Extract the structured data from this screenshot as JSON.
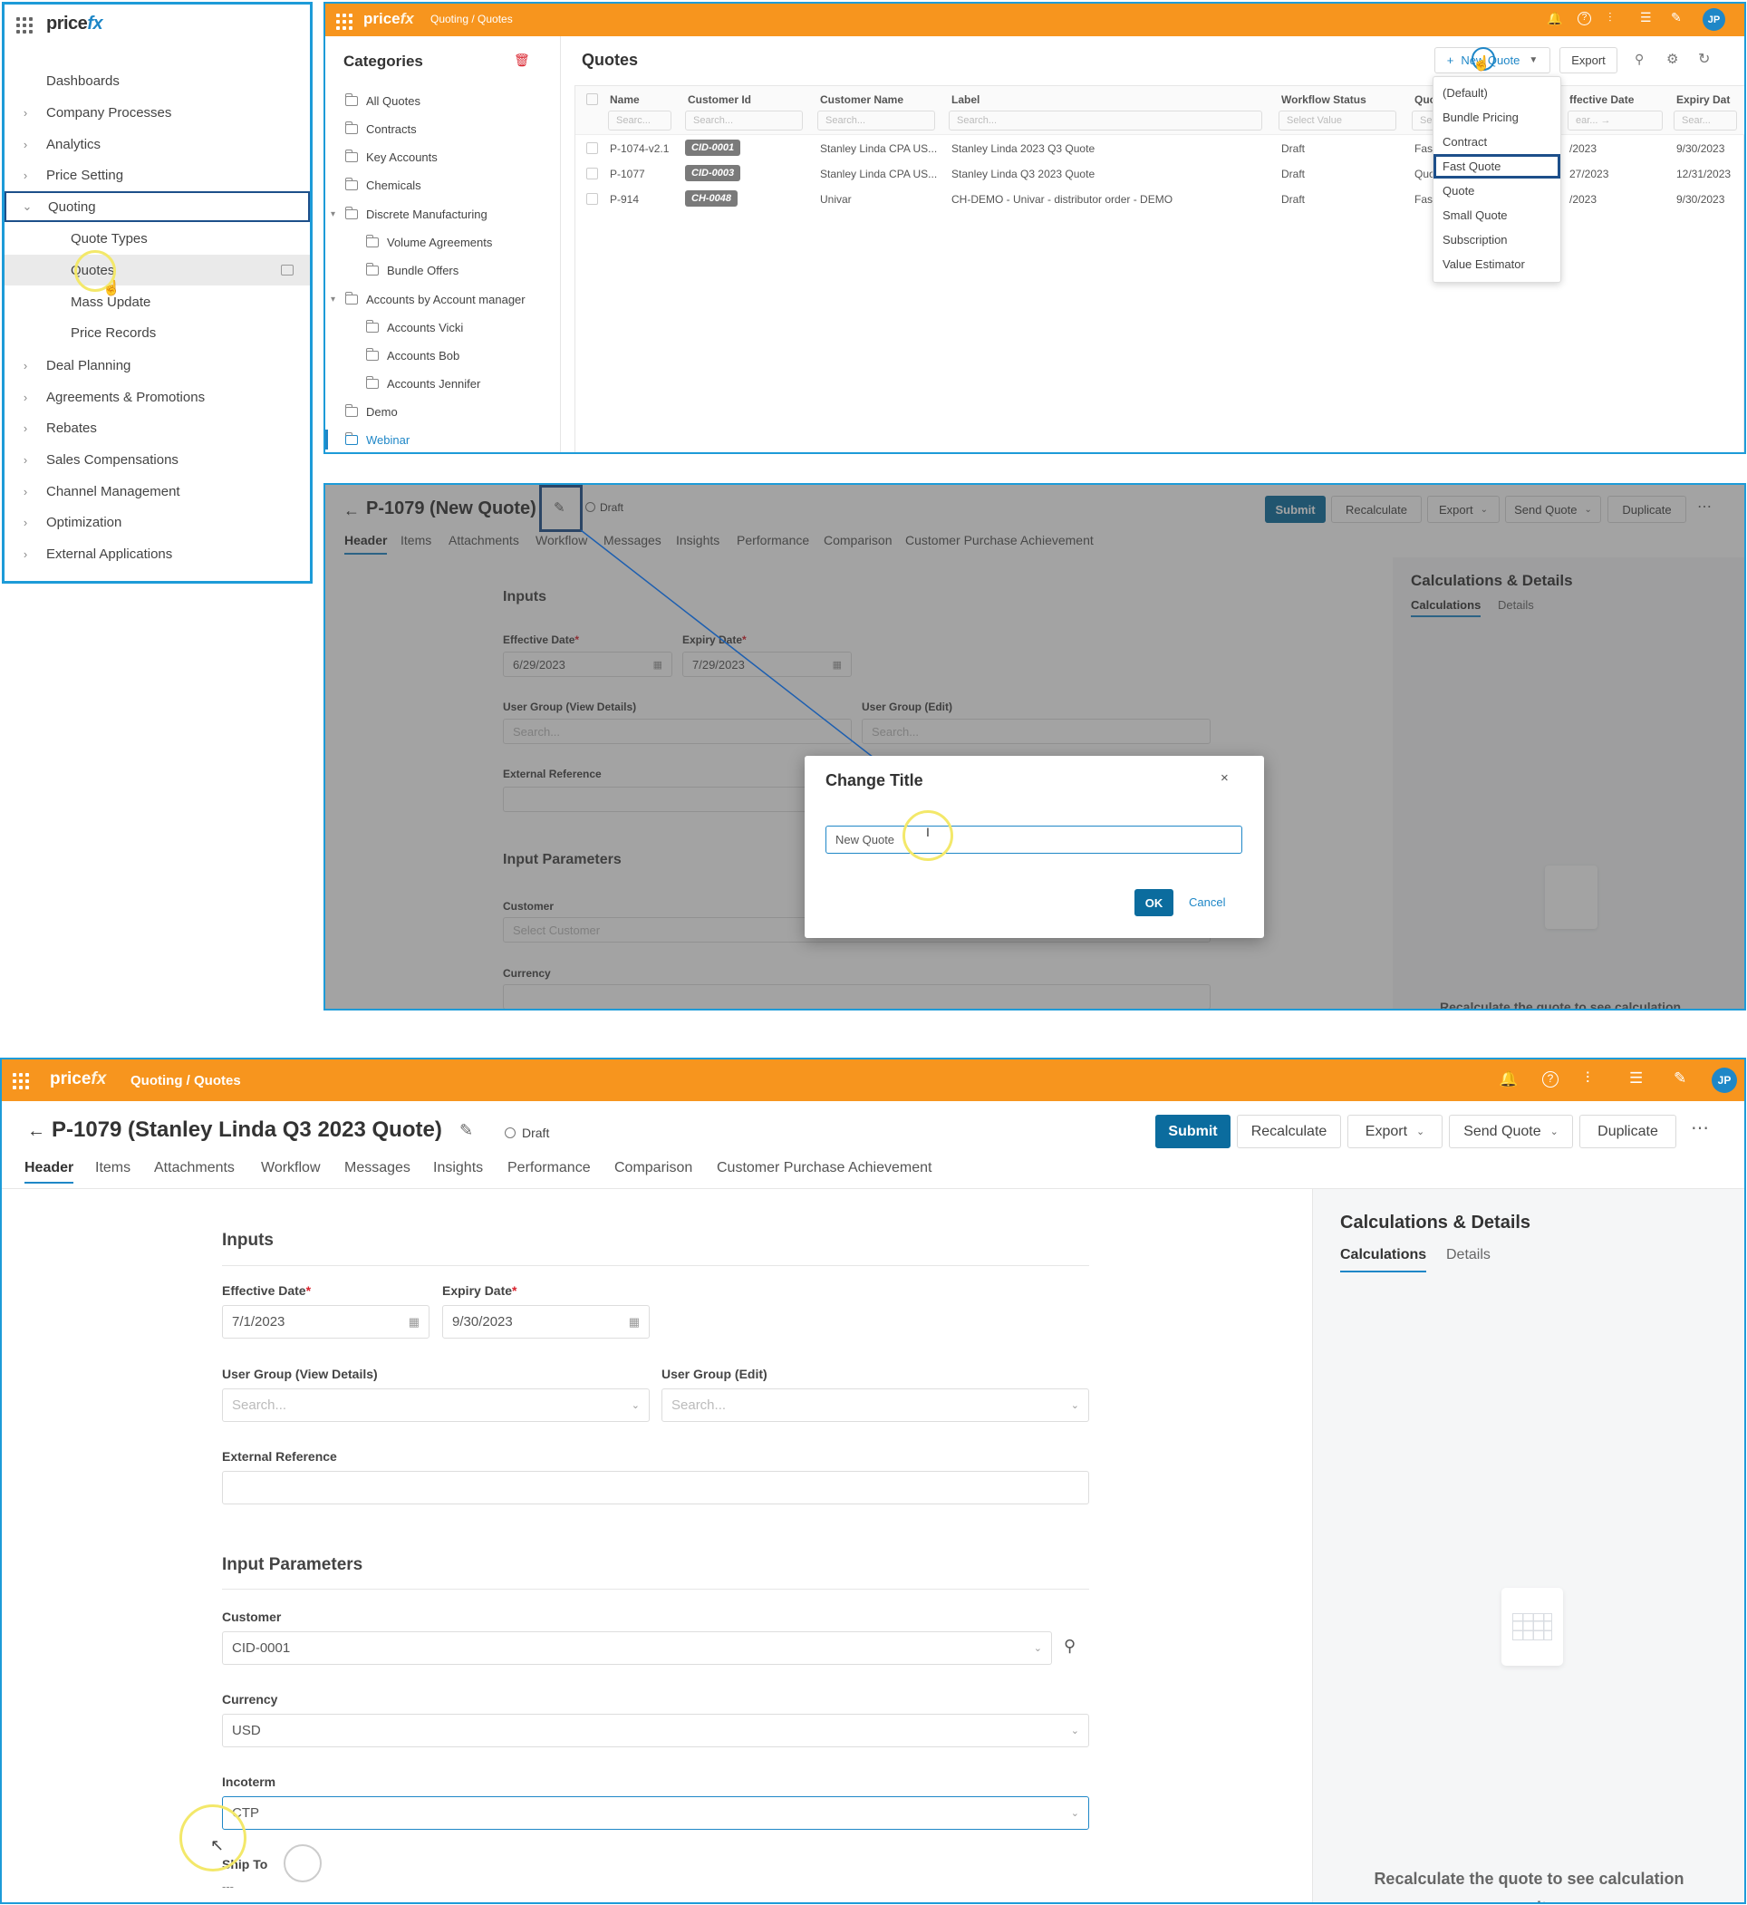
{
  "sidebar": {
    "brand_main": "price",
    "brand_fx": "fx",
    "items": [
      {
        "label": "Dashboards",
        "chevron": ""
      },
      {
        "label": "Company Processes",
        "chevron": "›"
      },
      {
        "label": "Analytics",
        "chevron": "›"
      },
      {
        "label": "Price Setting",
        "chevron": "›"
      },
      {
        "label": "Quoting",
        "chevron": "⌄"
      },
      {
        "label": "Quote Types",
        "chevron": ""
      },
      {
        "label": "Quotes",
        "chevron": ""
      },
      {
        "label": "Mass Update",
        "chevron": ""
      },
      {
        "label": "Price Records",
        "chevron": ""
      },
      {
        "label": "Deal Planning",
        "chevron": "›"
      },
      {
        "label": "Agreements & Promotions",
        "chevron": "›"
      },
      {
        "label": "Rebates",
        "chevron": "›"
      },
      {
        "label": "Sales Compensations",
        "chevron": "›"
      },
      {
        "label": "Channel Management",
        "chevron": "›"
      },
      {
        "label": "Optimization",
        "chevron": "›"
      },
      {
        "label": "External Applications",
        "chevron": "›"
      }
    ]
  },
  "topbar": {
    "brand_main": "price",
    "brand_fx": "fx",
    "breadcrumb": "Quoting / Quotes",
    "avatar": "JP",
    "accent": "#f7951e"
  },
  "categories": {
    "title": "Categories",
    "items": [
      {
        "label": "All Quotes",
        "chevron": ""
      },
      {
        "label": "Contracts",
        "chevron": ""
      },
      {
        "label": "Key Accounts",
        "chevron": ""
      },
      {
        "label": "Chemicals",
        "chevron": ""
      },
      {
        "label": "Discrete Manufacturing",
        "chevron": "▾"
      },
      {
        "label": "Volume Agreements",
        "chevron": ""
      },
      {
        "label": "Bundle Offers",
        "chevron": ""
      },
      {
        "label": "Accounts by Account manager",
        "chevron": "▾"
      },
      {
        "label": "Accounts Vicki",
        "chevron": ""
      },
      {
        "label": "Accounts Bob",
        "chevron": ""
      },
      {
        "label": "Accounts Jennifer",
        "chevron": ""
      },
      {
        "label": "Demo",
        "chevron": ""
      },
      {
        "label": "Webinar",
        "chevron": ""
      }
    ]
  },
  "quotes": {
    "title": "Quotes",
    "new_quote_label": "New Quote",
    "export_label": "Export",
    "columns": [
      "Name",
      "Customer Id",
      "Customer Name",
      "Label",
      "Workflow Status",
      "Quo",
      "ffective Date",
      "Expiry Dat"
    ],
    "filters": [
      "Searc...",
      "Search...",
      "Search...",
      "Search...",
      "Select Value",
      "Se",
      "ear... →",
      "Sear..."
    ],
    "rows": [
      {
        "name": "P-1074-v2.1",
        "customer_id": "CID-0001",
        "customer_name": "Stanley Linda CPA US...",
        "label": "Stanley Linda 2023 Q3 Quote",
        "status": "Draft",
        "type": "Fast",
        "effective": "/2023",
        "expiry": "9/30/2023"
      },
      {
        "name": "P-1077",
        "customer_id": "CID-0003",
        "customer_name": "Stanley Linda CPA US...",
        "label": "Stanley Linda Q3 2023 Quote",
        "status": "Draft",
        "type": "Quo",
        "effective": "27/2023",
        "expiry": "12/31/2023"
      },
      {
        "name": "P-914",
        "customer_id": "CH-0048",
        "customer_name": "Univar",
        "label": "CH-DEMO - Univar - distributor order - DEMO",
        "status": "Draft",
        "type": "Fast",
        "effective": "/2023",
        "expiry": "9/30/2023"
      }
    ],
    "new_quote_options": [
      "(Default)",
      "Bundle Pricing",
      "Contract",
      "Fast Quote",
      "Quote",
      "Small Quote",
      "Subscription",
      "Value Estimator"
    ]
  },
  "edit_dialog_view": {
    "title": "P-1079 (New Quote)",
    "status": "Draft",
    "actions": {
      "submit": "Submit",
      "recalculate": "Recalculate",
      "export": "Export",
      "send_quote": "Send Quote",
      "duplicate": "Duplicate"
    },
    "tabs": [
      "Header",
      "Items",
      "Attachments",
      "Workflow",
      "Messages",
      "Insights",
      "Performance",
      "Comparison",
      "Customer Purchase Achievement"
    ],
    "inputs_title": "Inputs",
    "effective_label": "Effective Date",
    "effective_value": "6/29/2023",
    "expiry_label": "Expiry Date",
    "expiry_value": "7/29/2023",
    "ug_view_label": "User Group (View Details)",
    "ug_view_ph": "Search...",
    "ug_edit_label": "User Group (Edit)",
    "ug_edit_ph": "Search...",
    "ext_ref_label": "External Reference",
    "params_title": "Input Parameters",
    "customer_label": "Customer",
    "customer_ph": "Select Customer",
    "currency_label": "Currency",
    "calc_title": "Calculations & Details",
    "calc_tab1": "Calculations",
    "calc_tab2": "Details",
    "calc_empty": "Recalculate the quote to see calculation",
    "dialog": {
      "title": "Change Title",
      "value": "New Quote",
      "ok": "OK",
      "cancel": "Cancel"
    }
  },
  "edit_full": {
    "title": "P-1079 (Stanley Linda Q3 2023 Quote)",
    "status": "Draft",
    "actions": {
      "submit": "Submit",
      "recalculate": "Recalculate",
      "export": "Export",
      "send_quote": "Send Quote",
      "duplicate": "Duplicate"
    },
    "tabs": [
      "Header",
      "Items",
      "Attachments",
      "Workflow",
      "Messages",
      "Insights",
      "Performance",
      "Comparison",
      "Customer Purchase Achievement"
    ],
    "inputs_title": "Inputs",
    "effective_label": "Effective Date",
    "effective_value": "7/1/2023",
    "expiry_label": "Expiry Date",
    "expiry_value": "9/30/2023",
    "ug_view_label": "User Group (View Details)",
    "ug_view_ph": "Search...",
    "ug_edit_label": "User Group (Edit)",
    "ug_edit_ph": "Search...",
    "ext_ref_label": "External Reference",
    "params_title": "Input Parameters",
    "customer_label": "Customer",
    "customer_value": "CID-0001",
    "currency_label": "Currency",
    "currency_value": "USD",
    "incoterm_label": "Incoterm",
    "incoterm_value": "CTP",
    "ship_to_label": "Ship To",
    "ship_to_value": "---",
    "calc_title": "Calculations & Details",
    "calc_tab1": "Calculations",
    "calc_tab2": "Details",
    "calc_empty_line1": "Recalculate the quote to see calculation",
    "calc_empty_line2": "results"
  }
}
